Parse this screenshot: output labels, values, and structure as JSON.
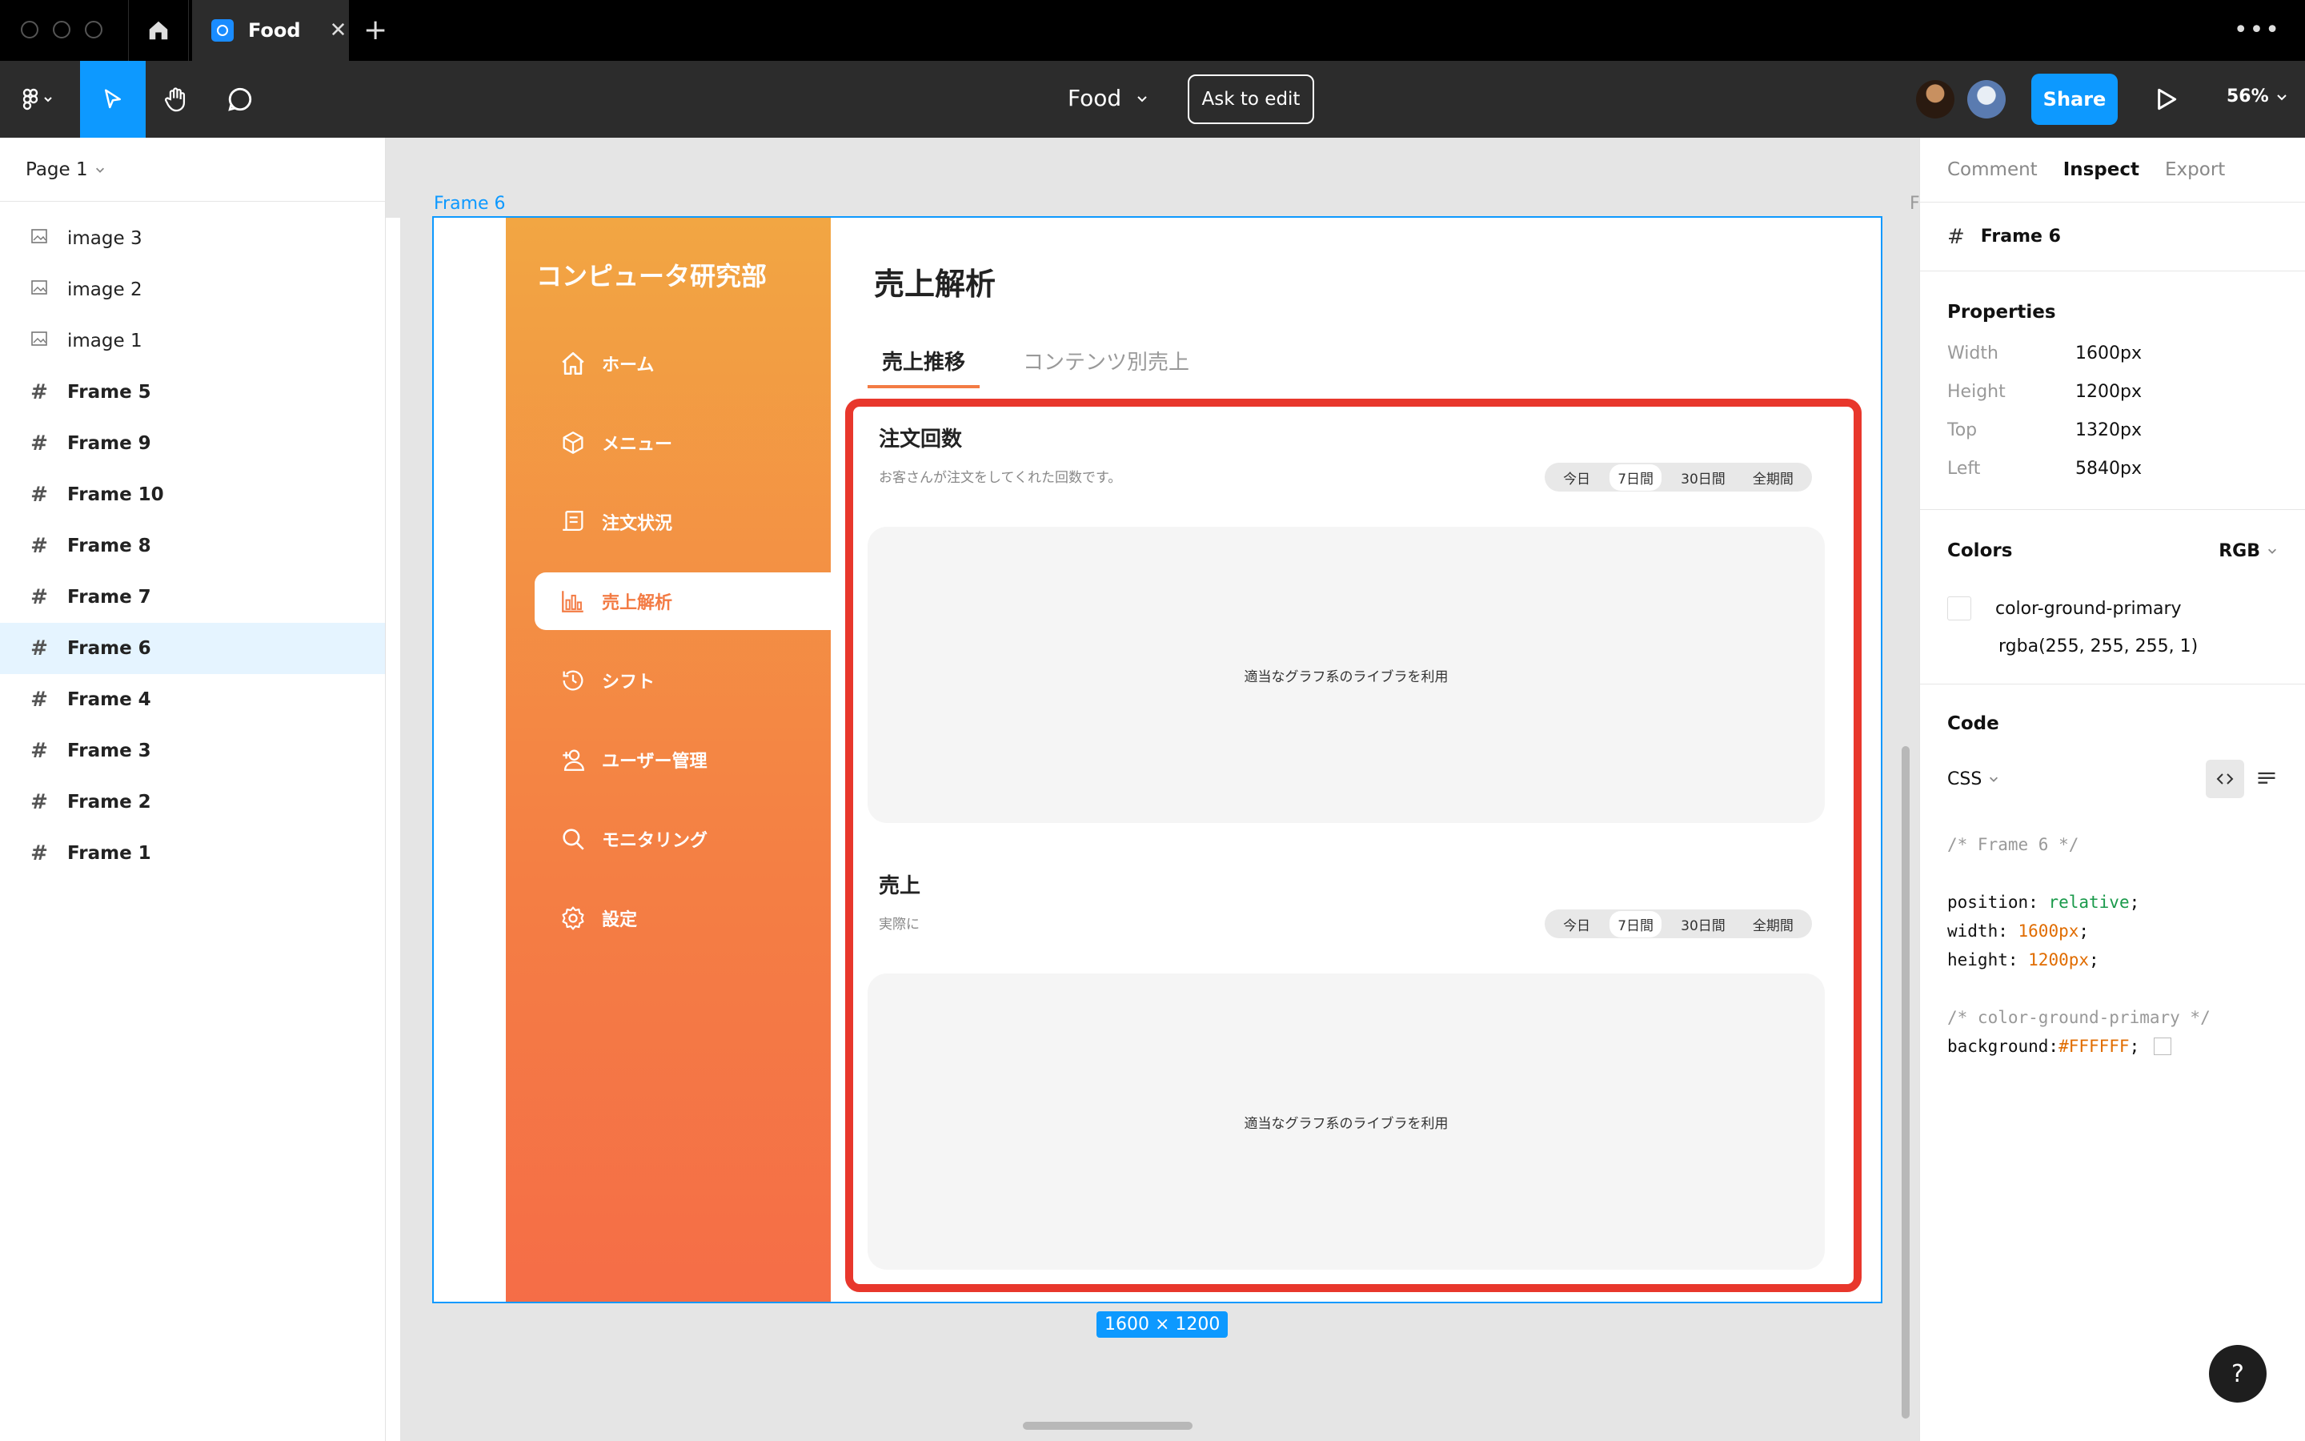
{
  "window": {
    "tab_title": "Food",
    "close_glyph": "✕",
    "new_tab_glyph": "+",
    "more_glyph": "•••"
  },
  "toolbar": {
    "file_name": "Food",
    "ask_to_edit": "Ask to edit",
    "share": "Share",
    "zoom": "56%"
  },
  "layers": {
    "page": "Page 1",
    "items": [
      {
        "label": "image 3",
        "type": "image"
      },
      {
        "label": "image 2",
        "type": "image"
      },
      {
        "label": "image 1",
        "type": "image"
      },
      {
        "label": "Frame 5",
        "type": "frame"
      },
      {
        "label": "Frame 9",
        "type": "frame"
      },
      {
        "label": "Frame 10",
        "type": "frame"
      },
      {
        "label": "Frame 8",
        "type": "frame"
      },
      {
        "label": "Frame 7",
        "type": "frame"
      },
      {
        "label": "Frame 6",
        "type": "frame",
        "selected": true
      },
      {
        "label": "Frame 4",
        "type": "frame"
      },
      {
        "label": "Frame 3",
        "type": "frame"
      },
      {
        "label": "Frame 2",
        "type": "frame"
      },
      {
        "label": "Frame 1",
        "type": "frame"
      }
    ]
  },
  "canvas": {
    "frame_label": "Frame 6",
    "frame_label_next": "F",
    "size_badge": "1600 × 1200",
    "design": {
      "brand": "コンピュータ研究部",
      "nav": [
        {
          "label": "ホーム",
          "icon": "home-icon"
        },
        {
          "label": "メニュー",
          "icon": "box-icon"
        },
        {
          "label": "注文状況",
          "icon": "receipt-icon"
        },
        {
          "label": "売上解析",
          "icon": "chart-icon",
          "active": true
        },
        {
          "label": "シフト",
          "icon": "history-icon"
        },
        {
          "label": "ユーザー管理",
          "icon": "user-add-icon"
        },
        {
          "label": "モニタリング",
          "icon": "search-icon"
        },
        {
          "label": "設定",
          "icon": "gear-icon"
        }
      ],
      "title": "売上解析",
      "tabs": [
        "売上推移",
        "コンテンツ別売上"
      ],
      "sections": [
        {
          "title": "注文回数",
          "subtitle": "お客さんが注文をしてくれた回数です。",
          "ranges": [
            "今日",
            "7日間",
            "30日間",
            "全期間"
          ],
          "selected_range": "7日間",
          "placeholder": "適当なグラフ系のライブラを利用"
        },
        {
          "title": "売上",
          "subtitle": "実際に",
          "ranges": [
            "今日",
            "7日間",
            "30日間",
            "全期間"
          ],
          "selected_range": "7日間",
          "placeholder": "適当なグラフ系のライブラを利用"
        }
      ]
    }
  },
  "inspect": {
    "tabs": [
      "Comment",
      "Inspect",
      "Export"
    ],
    "selection": "Frame 6",
    "properties_title": "Properties",
    "properties": [
      {
        "key": "Width",
        "value": "1600px"
      },
      {
        "key": "Height",
        "value": "1200px"
      },
      {
        "key": "Top",
        "value": "1320px"
      },
      {
        "key": "Left",
        "value": "5840px"
      }
    ],
    "colors_title": "Colors",
    "color_mode": "RGB",
    "color_name": "color-ground-primary",
    "color_value": "rgba(255, 255, 255, 1)",
    "code_title": "Code",
    "code_lang": "CSS",
    "code": {
      "comment1": "/* Frame 6 */",
      "l1_prop": "position: ",
      "l1_val": "relative",
      "l2_prop": "width: ",
      "l2_val": "1600px",
      "l3_prop": "height: ",
      "l3_val": "1200px",
      "comment2": "/* color-ground-primary */",
      "l4_prop": "background: ",
      "l4_val": "#FFFFFF"
    },
    "help": "?"
  },
  "colors": {
    "accent": "#0d99ff",
    "sidebar_top": "#f2a643",
    "sidebar_bottom": "#f56d47",
    "highlight": "#e8372c"
  }
}
